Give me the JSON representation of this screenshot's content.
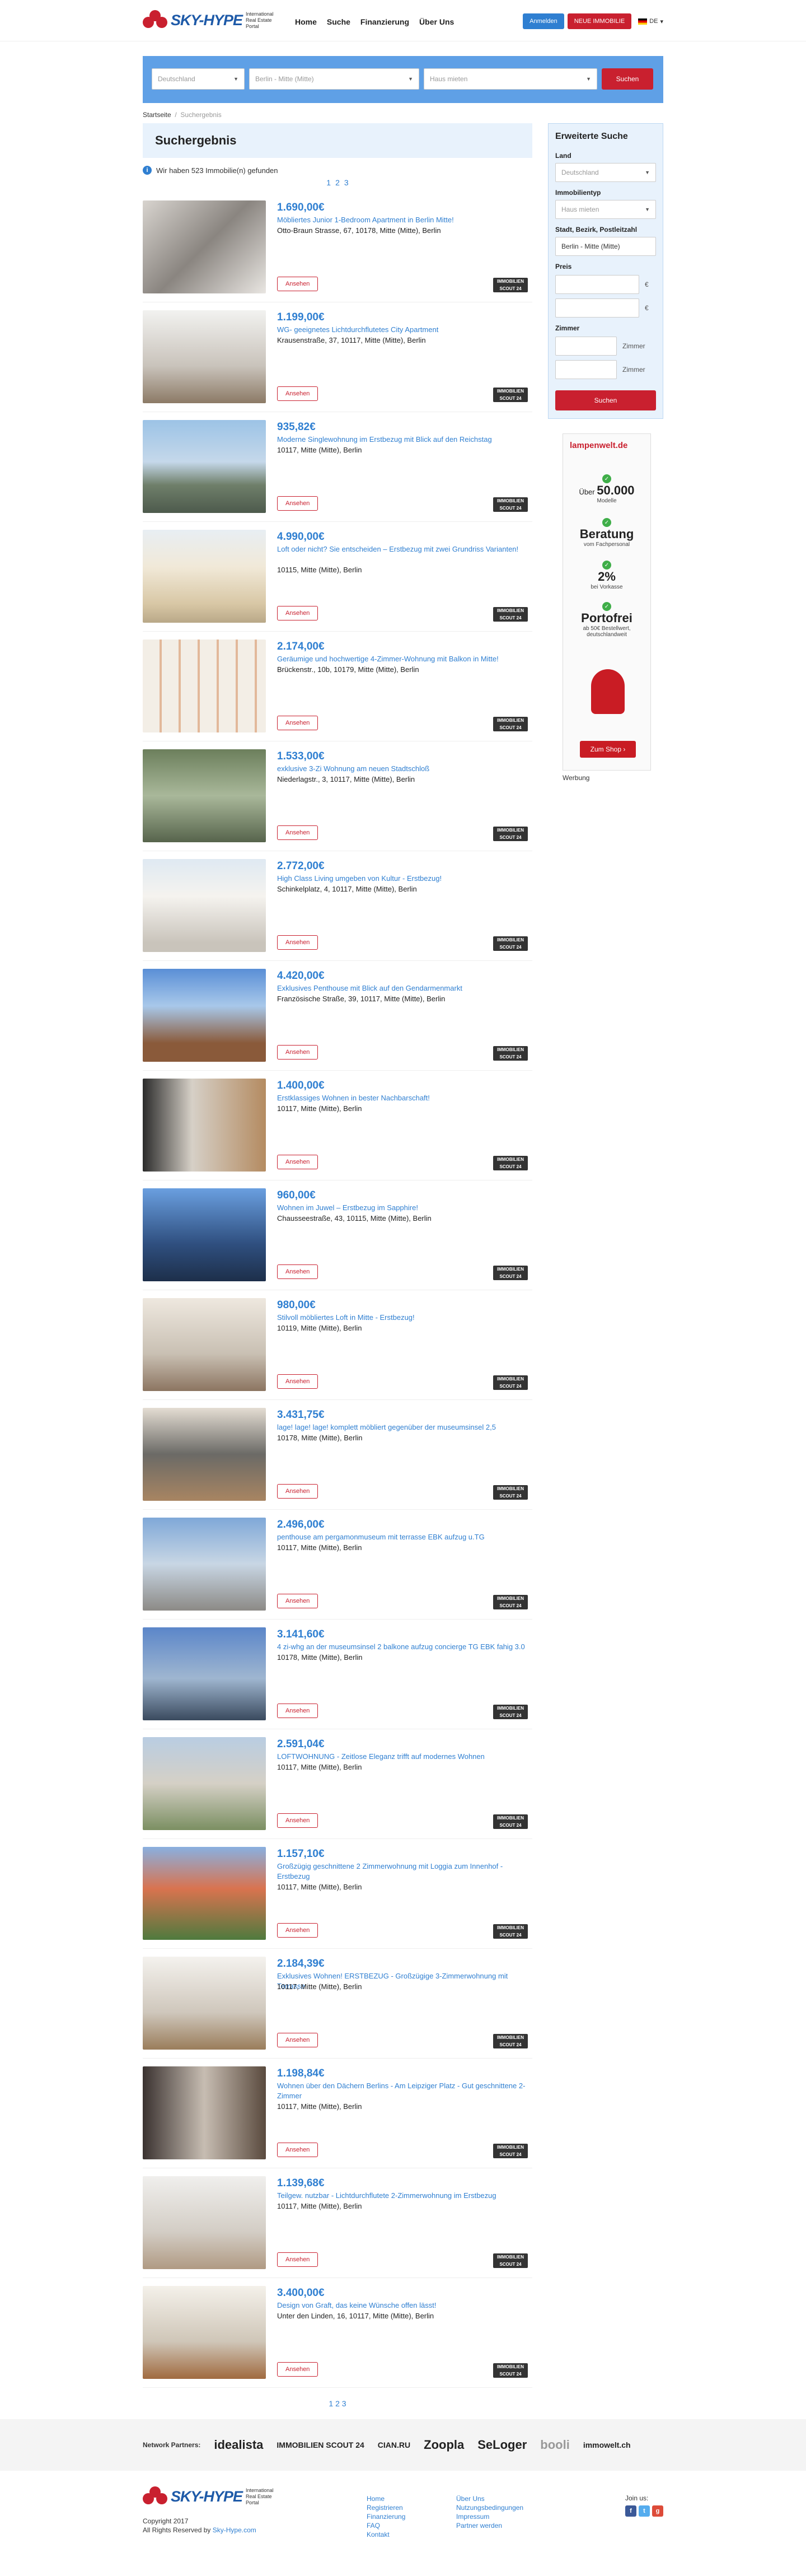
{
  "header": {
    "logo_text": "SKY-HYPE",
    "logo_sub": "International Real Estate Portal",
    "nav": [
      "Home",
      "Suche",
      "Finanzierung",
      "Über Uns"
    ],
    "login": "Anmelden",
    "new_property": "NEUE IMMOBILIE",
    "lang": "DE"
  },
  "search": {
    "country_placeholder": "Deutschland",
    "city_value": "Berlin - Mitte (Mitte)",
    "type_placeholder": "Haus mieten",
    "submit": "Suchen"
  },
  "breadcrumb": {
    "home": "Startseite",
    "current": "Suchergebnis"
  },
  "results": {
    "heading": "Suchergebnis",
    "count_text": "Wir haben 523 Immobilie(n) gefunden",
    "pages": [
      "1",
      "2",
      "3"
    ],
    "view_label": "Ansehen",
    "badge": "IMMOBILIEN SCOUT 24"
  },
  "listings": [
    {
      "price": "1.690,00€",
      "title": "Möbliertes Junior 1-Bedroom Apartment in Berlin Mitte!",
      "address": "Otto-Braun Strasse, 67, 10178, Mitte (Mitte), Berlin"
    },
    {
      "price": "1.199,00€",
      "title": "WG- geeignetes Lichtdurchflutetes City Apartment",
      "address": "Krausenstraße, 37, 10117, Mitte (Mitte), Berlin"
    },
    {
      "price": "935,82€",
      "title": "Moderne Singlewohnung im Erstbezug mit Blick auf den Reichstag",
      "address": "10117, Mitte (Mitte), Berlin"
    },
    {
      "price": "4.990,00€",
      "title": "Loft oder nicht? Sie entscheiden – Erstbezug mit zwei Grundriss Varianten!",
      "address": "10115, Mitte (Mitte), Berlin"
    },
    {
      "price": "2.174,00€",
      "title": "Geräumige und hochwertige 4-Zimmer-Wohnung mit Balkon in Mitte!",
      "address": "Brückenstr., 10b, 10179, Mitte (Mitte), Berlin"
    },
    {
      "price": "1.533,00€",
      "title": "exklusive 3-Zi Wohnung am neuen Stadtschloß",
      "address": "Niederlagstr., 3, 10117, Mitte (Mitte), Berlin"
    },
    {
      "price": "2.772,00€",
      "title": "High Class Living umgeben von Kultur - Erstbezug!",
      "address": "Schinkelplatz, 4, 10117, Mitte (Mitte), Berlin"
    },
    {
      "price": "4.420,00€",
      "title": "Exklusives Penthouse mit Blick auf den Gendarmenmarkt",
      "address": "Französische Straße, 39, 10117, Mitte (Mitte), Berlin"
    },
    {
      "price": "1.400,00€",
      "title": "Erstklassiges Wohnen in bester Nachbarschaft!",
      "address": "10117, Mitte (Mitte), Berlin"
    },
    {
      "price": "960,00€",
      "title": "Wohnen im Juwel – Erstbezug im Sapphire!",
      "address": "Chausseestraße, 43, 10115, Mitte (Mitte), Berlin"
    },
    {
      "price": "980,00€",
      "title": "Stilvoll möbliertes Loft in Mitte - Erstbezug!",
      "address": "10119, Mitte (Mitte), Berlin"
    },
    {
      "price": "3.431,75€",
      "title": "lage! lage! lage! komplett möbliert gegenüber der museumsinsel 2,5",
      "address": "10178, Mitte (Mitte), Berlin"
    },
    {
      "price": "2.496,00€",
      "title": "penthouse am pergamonmuseum mit terrasse EBK aufzug u.TG",
      "address": "10117, Mitte (Mitte), Berlin"
    },
    {
      "price": "3.141,60€",
      "title": "4 zi-whg an der museumsinsel 2 balkone aufzug concierge TG EBK fahig 3.0",
      "address": "10178, Mitte (Mitte), Berlin"
    },
    {
      "price": "2.591,04€",
      "title": "LOFTWOHNUNG - Zeitlose Eleganz trifft auf modernes Wohnen",
      "address": "10117, Mitte (Mitte), Berlin"
    },
    {
      "price": "1.157,10€",
      "title": "Großzügig geschnittene 2 Zimmerwohnung mit Loggia zum Innenhof - Erstbezug",
      "address": "10117, Mitte (Mitte), Berlin"
    },
    {
      "price": "2.184,39€",
      "title": "Exklusives Wohnen! ERSTBEZUG - Großzügige 3-Zimmerwohnung mit Terrasse",
      "address": "10117, Mitte (Mitte), Berlin"
    },
    {
      "price": "1.198,84€",
      "title": "Wohnen über den Dächern Berlins - Am Leipziger Platz - Gut geschnittene 2-Zimmer",
      "address": "10117, Mitte (Mitte), Berlin"
    },
    {
      "price": "1.139,68€",
      "title": "Teilgew. nutzbar - Lichtdurchflutete 2-Zimmerwohnung im Erstbezug",
      "address": "10117, Mitte (Mitte), Berlin"
    },
    {
      "price": "3.400,00€",
      "title": "Design von Graft, das keine Wünsche offen lässt!",
      "address": "Unter den Linden, 16, 10117, Mitte (Mitte), Berlin"
    }
  ],
  "sidebar": {
    "heading": "Erweiterte Suche",
    "country_label": "Land",
    "country_value": "Deutschland",
    "type_label": "Immobilientyp",
    "type_value": "Haus mieten",
    "city_label": "Stadt, Bezirk, Postleitzahl",
    "city_value": "Berlin - Mitte (Mitte)",
    "price_label": "Preis",
    "currency": "€",
    "rooms_label": "Zimmer",
    "rooms_unit": "Zimmer",
    "submit": "Suchen"
  },
  "ad": {
    "brand": "lampenwelt.de",
    "item1_big": "50.000",
    "item1_pre": "Über",
    "item1_small": "Modelle",
    "item2_big": "Beratung",
    "item2_small": "vom Fachpersonal",
    "item3_big": "2%",
    "item3_small": "bei Vorkasse",
    "item4_big": "Portofrei",
    "item4_small": "ab 50€ Bestellwert, deutschlandweit",
    "cta": "Zum Shop",
    "label": "Werbung"
  },
  "partners": {
    "label": "Network Partners:",
    "names": [
      "idealista",
      "IMMOBILIEN SCOUT 24",
      "CIAN.RU",
      "Zoopla",
      "SeLoger",
      "booli",
      "immowelt.ch"
    ]
  },
  "footer": {
    "copyright": "Copyright 2017",
    "rights_prefix": "All Rights Reserved by",
    "rights_link": "Sky-Hype.com",
    "col1": [
      "Home",
      "Registrieren",
      "Finanzierung",
      "FAQ",
      "Kontakt"
    ],
    "col2": [
      "Über Uns",
      "Nutzungsbedingungen",
      "Impressum",
      "Partner werden"
    ],
    "join": "Join us:"
  },
  "colors": {
    "brand_blue": "#2f7fd1",
    "brand_red": "#c9202f",
    "search_bg": "#5fa0e6"
  }
}
